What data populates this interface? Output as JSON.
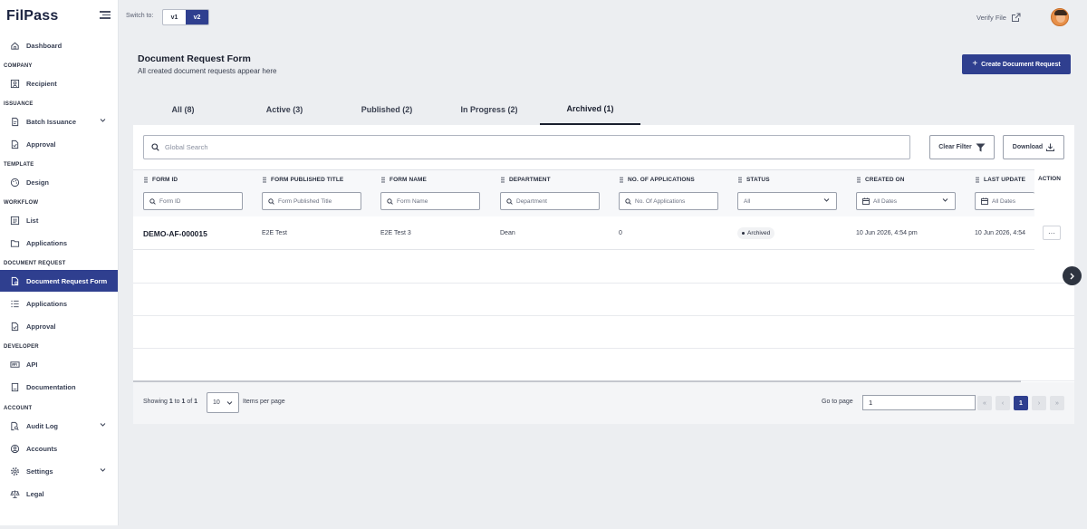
{
  "app": {
    "logo_text": "FilPass"
  },
  "topbar": {
    "switch_label": "Switch to:",
    "versions": [
      "v1",
      "v2"
    ],
    "active_version": "v2",
    "verify_label": "Verify File"
  },
  "sidebar": {
    "sections": {
      "company": "COMPANY",
      "issuance": "ISSUANCE",
      "template": "TEMPLATE",
      "workflow": "WORKFLOW",
      "document_request": "DOCUMENT REQUEST",
      "developer": "DEVELOPER",
      "account": "ACCOUNT"
    },
    "items": {
      "dashboard": "Dashboard",
      "recipient": "Recipient",
      "batch_issuance": "Batch Issuance",
      "approval": "Approval",
      "design": "Design",
      "list": "List",
      "applications": "Applications",
      "document_request_form": "Document Request Form",
      "dr_applications": "Applications",
      "dr_approval": "Approval",
      "api": "API",
      "documentation": "Documentation",
      "audit_log": "Audit Log",
      "accounts": "Accounts",
      "settings": "Settings",
      "legal": "Legal"
    },
    "active_item": "Document Request Form"
  },
  "header": {
    "title": "Document Request Form",
    "subtitle": "All created document requests appear here",
    "create_button": "Create Document Request"
  },
  "tabs": [
    {
      "label": "All (8)"
    },
    {
      "label": "Active (3)"
    },
    {
      "label": "Published (2)"
    },
    {
      "label": "In Progress (2)"
    },
    {
      "label": "Archived (1)"
    }
  ],
  "active_tab": "Archived (1)",
  "toolbar": {
    "search_placeholder": "Global Search",
    "clear_filter": "Clear Filter",
    "download": "Download"
  },
  "table": {
    "columns": [
      {
        "label": "FORM ID",
        "filter": "Form ID"
      },
      {
        "label": "FORM PUBLISHED TITLE",
        "filter": "Form Published Title"
      },
      {
        "label": "FORM NAME",
        "filter": "Form Name"
      },
      {
        "label": "DEPARTMENT",
        "filter": "Department"
      },
      {
        "label": "NO. OF APPLICATIONS",
        "filter": "No. Of Applications"
      },
      {
        "label": "STATUS",
        "filter": "All"
      },
      {
        "label": "CREATED ON",
        "filter": "All Dates"
      },
      {
        "label": "LAST UPDATE",
        "filter": "All Dates"
      }
    ],
    "action_header": "ACTION",
    "action_button": "···",
    "rows": [
      {
        "form_id": "DEMO-AF-000015",
        "published_title": "E2E Test",
        "form_name": "E2E Test 3",
        "department": "Dean",
        "applications": "0",
        "status": "Archived",
        "created_on": "10 Jun 2026, 4:54 pm",
        "last_updated": "10 Jun 2026, 4:54"
      }
    ]
  },
  "pagination": {
    "showing_prefix": "Showing",
    "from": "1",
    "to_word": "to",
    "to": "1",
    "of_word": "of",
    "total": "1",
    "per_page": "10",
    "per_page_label": "Items per page",
    "goto_label": "Go to page",
    "goto_value": "1",
    "first": "«",
    "prev": "‹",
    "current": "1",
    "next": "›",
    "last": "»"
  }
}
